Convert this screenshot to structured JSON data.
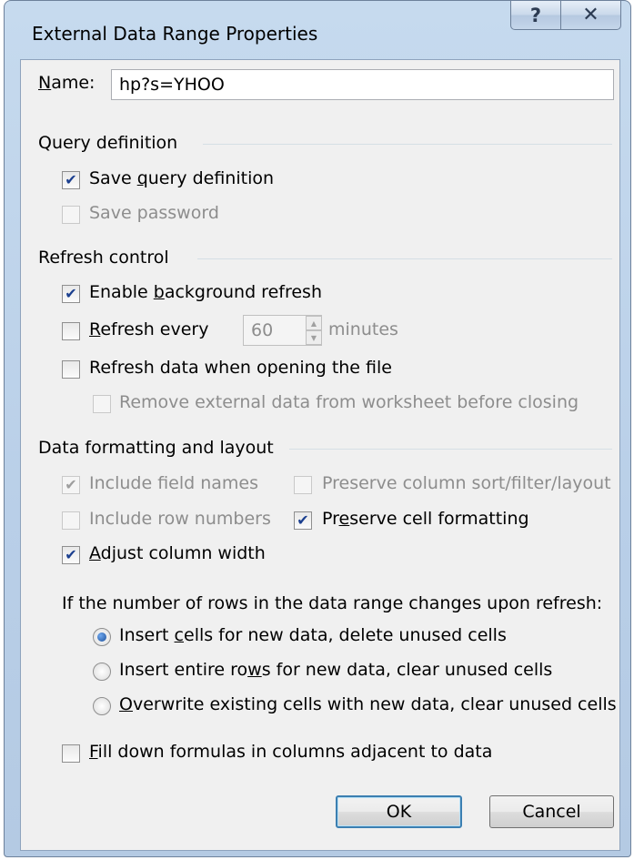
{
  "window": {
    "title": "External Data Range Properties",
    "help_glyph": "?",
    "close_glyph": "✕"
  },
  "name": {
    "label_key": "N",
    "label_rest": "ame:",
    "value": "hp?s=YHOO"
  },
  "query_definition": {
    "title": "Query definition",
    "save_query": {
      "pre": "Save ",
      "key": "q",
      "post": "uery definition",
      "checked": true,
      "enabled": true
    },
    "save_password": {
      "label": "Save password",
      "checked": false,
      "enabled": false
    }
  },
  "refresh_control": {
    "title": "Refresh control",
    "background_refresh": {
      "pre": "Enable ",
      "key": "b",
      "post": "ackground refresh",
      "checked": true,
      "enabled": true
    },
    "refresh_every": {
      "pre": "",
      "key": "R",
      "post": "efresh every",
      "checked": false,
      "value": "60",
      "unit": "minutes"
    },
    "refresh_on_open": {
      "pre": "Refresh data when opening the f",
      "key": "i",
      "post": "le",
      "checked": false
    },
    "remove_external": {
      "label": "Remove external data from worksheet before closing",
      "checked": false,
      "enabled": false
    }
  },
  "data_formatting": {
    "title": "Data formatting and layout",
    "include_field_names": {
      "label": "Include field names",
      "checked": true,
      "enabled": false
    },
    "include_row_numbers": {
      "label": "Include row numbers",
      "checked": false,
      "enabled": false
    },
    "adjust_column_width": {
      "pre": "",
      "key": "A",
      "post": "djust column width",
      "checked": true,
      "enabled": true
    },
    "preserve_sort": {
      "label": "Preserve column sort/filter/layout",
      "checked": false,
      "enabled": false
    },
    "preserve_cell_formatting": {
      "pre": "Pr",
      "key": "e",
      "post": "serve cell formatting",
      "checked": true,
      "enabled": true
    },
    "rows_change_prompt": "If the number of rows in the data range changes upon refresh:",
    "options": [
      {
        "pre": "Insert ",
        "key": "c",
        "post": "ells for new data, delete unused cells",
        "selected": true
      },
      {
        "pre": "Insert entire ro",
        "key": "w",
        "post": "s for new data, clear unused cells",
        "selected": false
      },
      {
        "pre": "",
        "key": "O",
        "post": "verwrite existing cells with new data, clear unused cells",
        "selected": false
      }
    ],
    "fill_down": {
      "pre": "",
      "key": "F",
      "post": "ill down formulas in columns adjacent to data",
      "checked": false
    }
  },
  "buttons": {
    "ok": "OK",
    "cancel": "Cancel"
  },
  "glyphs": {
    "check": "✔",
    "spin_up": "▲",
    "spin_down": "▼"
  }
}
